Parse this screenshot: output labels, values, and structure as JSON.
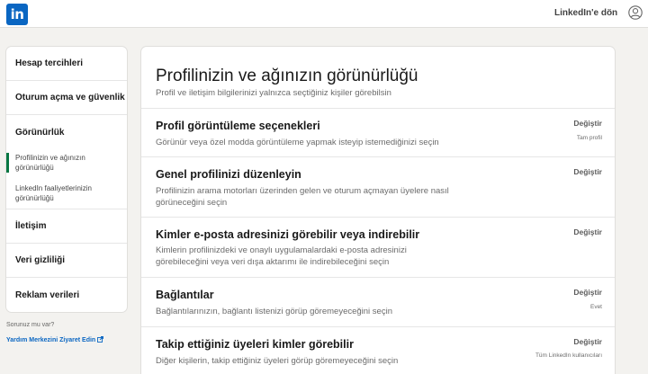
{
  "header": {
    "logo_text": "in",
    "back_link": "LinkedIn'e dön",
    "avatar_icon": "user-avatar-icon"
  },
  "sidebar": {
    "items": [
      {
        "label": "Hesap tercihleri"
      },
      {
        "label": "Oturum açma ve güvenlik"
      },
      {
        "label": "Görünürlük"
      },
      {
        "label": "İletişim"
      },
      {
        "label": "Veri gizliliği"
      },
      {
        "label": "Reklam verileri"
      }
    ],
    "subitems": [
      {
        "label": "Profilinizin ve ağınızın görünürlüğü",
        "active": true
      },
      {
        "label": "LinkedIn faaliyetlerinizin görünürlüğü",
        "active": false
      }
    ],
    "active_color": "#057642",
    "help_question": "Sorunuz mu var?",
    "help_link": "Yardım Merkezini Ziyaret Edin"
  },
  "main": {
    "title": "Profilinizin ve ağınızın görünürlüğü",
    "subtitle": "Profil ve iletişim bilgilerinizi yalnızca seçtiğiniz kişiler görebilsin",
    "rows": [
      {
        "title": "Profil görüntüleme seçenekleri",
        "description": "Görünür veya özel modda görüntüleme yapmak isteyip istemediğinizi seçin",
        "action": "Değiştir",
        "value": "Tam profil"
      },
      {
        "title": "Genel profilinizi düzenleyin",
        "description": "Profilinizin arama motorları üzerinden gelen ve oturum açmayan üyelere nasıl görüneceğini seçin",
        "action": "Değiştir",
        "value": ""
      },
      {
        "title": "Kimler e-posta adresinizi görebilir veya indirebilir",
        "description": "Kimlerin profilinizdeki ve onaylı uygulamalardaki e-posta adresinizi görebileceğini veya veri dışa aktarımı ile indirebileceğini seçin",
        "action": "Değiştir",
        "value": ""
      },
      {
        "title": "Bağlantılar",
        "description": "Bağlantılarınızın, bağlantı listenizi görüp göremeyeceğini seçin",
        "action": "Değiştir",
        "value": "Evet"
      },
      {
        "title": "Takip ettiğiniz üyeleri kimler görebilir",
        "description": "Diğer kişilerin, takip ettiğiniz üyeleri görüp göremeyeceğini seçin",
        "action": "Değiştir",
        "value": "Tüm LinkedIn kullanıcıları"
      }
    ]
  },
  "colors": {
    "brand": "#0a66c2",
    "page_bg": "#f3f2ef"
  }
}
